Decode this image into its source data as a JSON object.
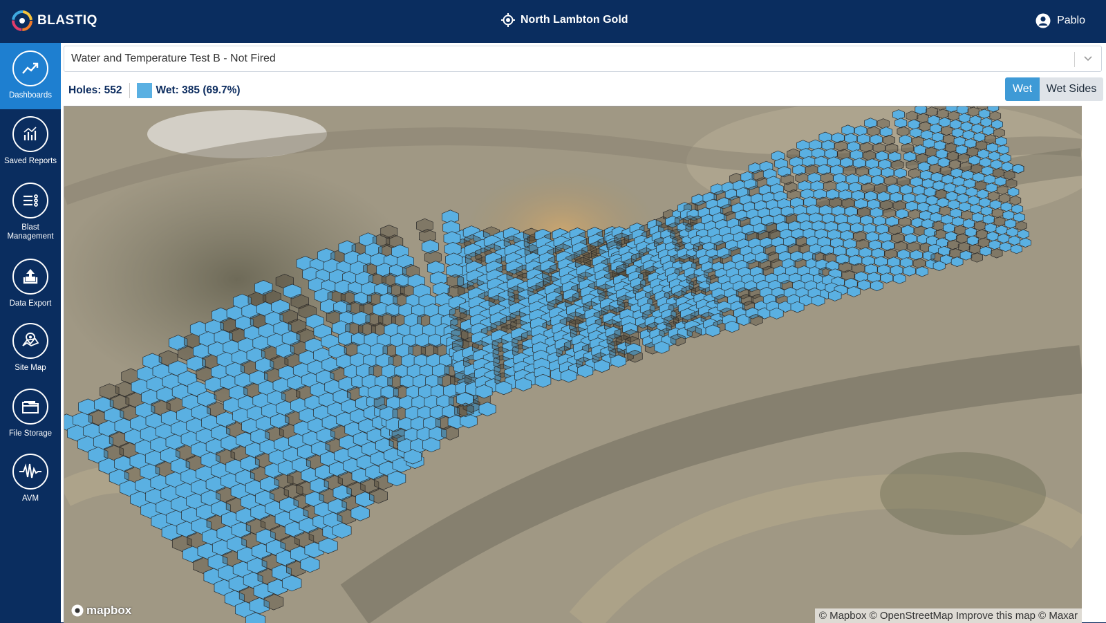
{
  "header": {
    "logo_text": "BLASTIQ",
    "site_name": "North Lambton Gold",
    "user_name": "Pablo",
    "logo_icon": "blastiq-ring-logo",
    "site_icon": "crosshair-location-icon",
    "user_icon": "user-avatar-icon"
  },
  "sidebar": {
    "items": [
      {
        "label": "Dashboards",
        "icon": "trend-chart-icon",
        "active": true
      },
      {
        "label": "Saved Reports",
        "icon": "report-chart-icon",
        "active": false
      },
      {
        "label": "Blast Management",
        "icon": "list-settings-icon",
        "active": false
      },
      {
        "label": "Data Export",
        "icon": "export-upload-icon",
        "active": false
      },
      {
        "label": "Site Map",
        "icon": "map-pin-icon",
        "active": false
      },
      {
        "label": "File Storage",
        "icon": "folder-icon",
        "active": false
      },
      {
        "label": "AVM",
        "icon": "waveform-icon",
        "active": false
      }
    ]
  },
  "selector": {
    "value": "Water and Temperature Test B - Not Fired"
  },
  "stats": {
    "holes_label": "Holes: 552",
    "wet_label": "Wet: 385 (69.7%)",
    "wet_color": "#5ab0e2"
  },
  "toggle": {
    "wet": "Wet",
    "wet_sides": "Wet Sides"
  },
  "map": {
    "mapbox_logo": "mapbox",
    "attribution": "© Mapbox © OpenStreetMap Improve this map © Maxar",
    "hole_colors": {
      "wet": "#5ab0e2",
      "dry": "rgba(70,60,45,0.35)",
      "outline": "#2a2a2a"
    }
  },
  "colors": {
    "header_bg": "#0a2d5f",
    "active_nav": "#1e7fd0",
    "toggle_active": "#3e9ad6"
  }
}
